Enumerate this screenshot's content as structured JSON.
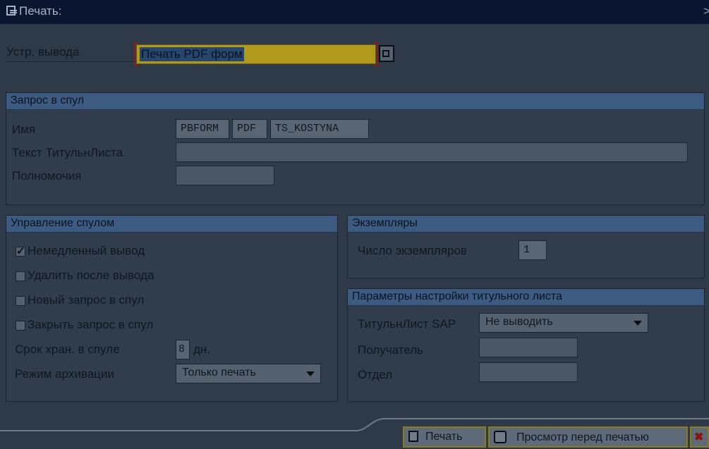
{
  "window": {
    "title": "Печать:",
    "close_glyph": ">"
  },
  "output": {
    "label": "Устр. вывода",
    "value": "Печать PDF форм"
  },
  "spool_request": {
    "title": "Запрос в спул",
    "name_label": "Имя",
    "name_parts": [
      "PBFORM",
      "PDF",
      "TS_KOSTYNA"
    ],
    "cover_text_label": "Текст ТитульнЛиста",
    "cover_text_value": "",
    "auth_label": "Полномочия",
    "auth_value": ""
  },
  "spool_control": {
    "title": "Управление спулом",
    "checkboxes": [
      {
        "label": "Немедленный вывод",
        "checked": true
      },
      {
        "label": "Удалить после вывода",
        "checked": false
      },
      {
        "label": "Новый запрос в спул",
        "checked": false
      },
      {
        "label": "Закрыть запрос в спул",
        "checked": false
      }
    ],
    "retention_label": "Срок хран. в спуле",
    "retention_value": "8",
    "retention_unit": "дн.",
    "archive_label": "Режим архивации",
    "archive_value": "Только печать"
  },
  "copies": {
    "title": "Экземпляры",
    "count_label": "Число экземпляров",
    "count_value": "1"
  },
  "cover_sheet": {
    "title": "Параметры настройки титульного листа",
    "sap_label": "ТитульнЛист SAP",
    "sap_value": "Не выводить",
    "recipient_label": "Получатель",
    "recipient_value": "",
    "department_label": "Отдел",
    "department_value": ""
  },
  "footer": {
    "print_label": "Печать",
    "preview_label": "Просмотр перед печатью",
    "cancel_glyph": "✖"
  },
  "colors": {
    "accent_field": "#b09a1e",
    "group_header": "#3d5a80",
    "button_border": "#8a7a1e"
  }
}
